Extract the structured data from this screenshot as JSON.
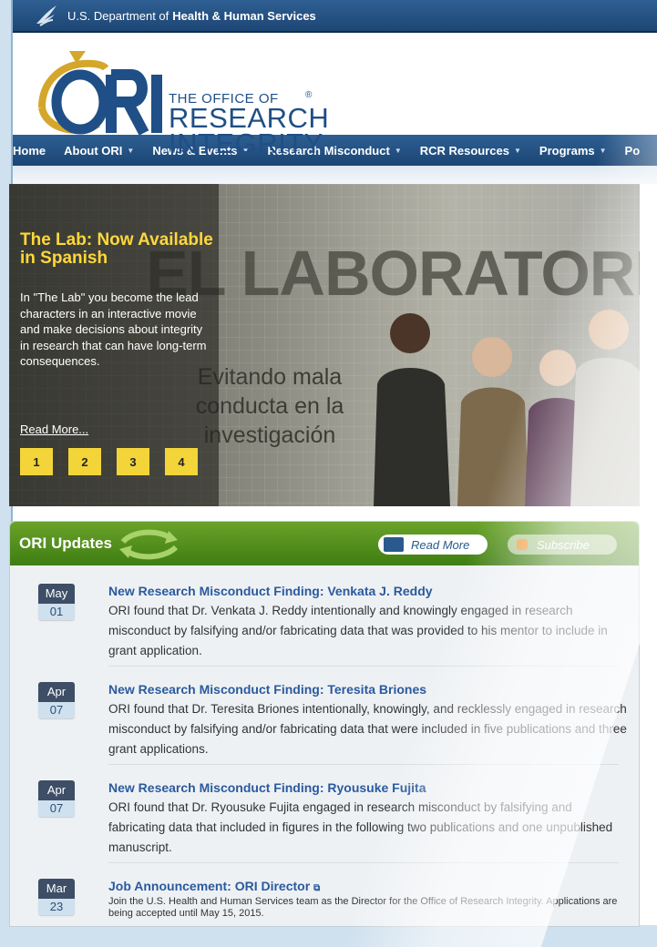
{
  "header": {
    "agency_prefix": "U.S. Department of",
    "agency_bold": "Health & Human Services"
  },
  "logo": {
    "line1": "THE OFFICE OF",
    "line2": "RESEARCH",
    "line3": "INTEGRITY",
    "reg": "®"
  },
  "nav": {
    "items": [
      {
        "label": "Home",
        "has_menu": false
      },
      {
        "label": "About ORI",
        "has_menu": true
      },
      {
        "label": "News & Events",
        "has_menu": true
      },
      {
        "label": "Research Misconduct",
        "has_menu": true
      },
      {
        "label": "RCR Resources",
        "has_menu": true
      },
      {
        "label": "Programs",
        "has_menu": true
      },
      {
        "label": "Po",
        "has_menu": false
      }
    ]
  },
  "slider": {
    "image_title": "EL LABORATORIO:",
    "image_subtitle_lines": [
      "Evitando mala",
      "conducta en la",
      "investigación"
    ],
    "heading": "The Lab: Now Available in Spanish",
    "body": "In \"The Lab\" you become the lead characters in an interactive movie and make decisions about integrity in research that can have long-term consequences.",
    "read_more": "Read More...",
    "pages": [
      "1",
      "2",
      "3",
      "4"
    ]
  },
  "updates": {
    "title": "ORI Updates",
    "read_more": "Read More",
    "subscribe": "Subscribe",
    "items": [
      {
        "month": "May",
        "day": "01",
        "title": "New Research Misconduct Finding: Venkata J. Reddy",
        "body": "ORI found that Dr. Venkata J. Reddy intentionally and knowingly engaged in research misconduct by falsifying and/or fabricating data that was provided to his mentor to include in grant application."
      },
      {
        "month": "Apr",
        "day": "07",
        "title": "New Research Misconduct Finding: Teresita Briones",
        "body": "ORI found that Dr. Teresita Briones intentionally, knowingly, and recklessly engaged in research misconduct by falsifying and/or fabricating data that were included in five publications and three grant applications."
      },
      {
        "month": "Apr",
        "day": "07",
        "title": "New Research Misconduct Finding: Ryousuke Fujita",
        "body": "ORI found that Dr. Ryousuke Fujita engaged in research misconduct by falsifying and fabricating data that included in figures in the following two publications and one unpublished manuscript."
      },
      {
        "month": "Mar",
        "day": "23",
        "title": "Job Announcement: ORI Director",
        "body": "Join the U.S. Health and Human Services team as the Director for the Office of Research Integrity.  Applications are being accepted until May 15, 2015."
      }
    ]
  },
  "colors": {
    "nav_blue": "#2e5f92",
    "updates_green": "#4f8c1a",
    "accent_yellow": "#ffd83a",
    "link_blue": "#2a5a9d"
  }
}
